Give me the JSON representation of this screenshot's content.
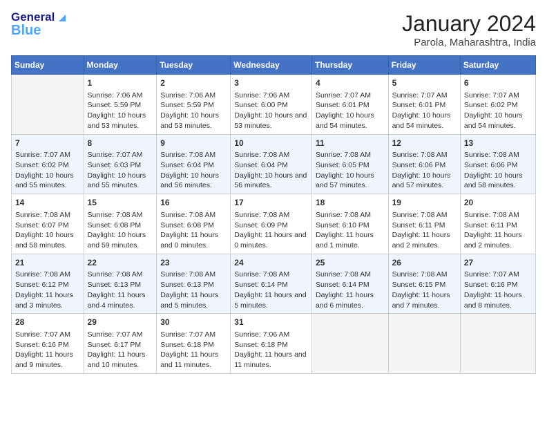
{
  "header": {
    "logo_general": "General",
    "logo_blue": "Blue",
    "title": "January 2024",
    "subtitle": "Parola, Maharashtra, India"
  },
  "days_of_week": [
    "Sunday",
    "Monday",
    "Tuesday",
    "Wednesday",
    "Thursday",
    "Friday",
    "Saturday"
  ],
  "weeks": [
    [
      {
        "day": "",
        "empty": true
      },
      {
        "day": "1",
        "sunrise": "Sunrise: 7:06 AM",
        "sunset": "Sunset: 5:59 PM",
        "daylight": "Daylight: 10 hours and 53 minutes."
      },
      {
        "day": "2",
        "sunrise": "Sunrise: 7:06 AM",
        "sunset": "Sunset: 5:59 PM",
        "daylight": "Daylight: 10 hours and 53 minutes."
      },
      {
        "day": "3",
        "sunrise": "Sunrise: 7:06 AM",
        "sunset": "Sunset: 6:00 PM",
        "daylight": "Daylight: 10 hours and 53 minutes."
      },
      {
        "day": "4",
        "sunrise": "Sunrise: 7:07 AM",
        "sunset": "Sunset: 6:01 PM",
        "daylight": "Daylight: 10 hours and 54 minutes."
      },
      {
        "day": "5",
        "sunrise": "Sunrise: 7:07 AM",
        "sunset": "Sunset: 6:01 PM",
        "daylight": "Daylight: 10 hours and 54 minutes."
      },
      {
        "day": "6",
        "sunrise": "Sunrise: 7:07 AM",
        "sunset": "Sunset: 6:02 PM",
        "daylight": "Daylight: 10 hours and 54 minutes."
      }
    ],
    [
      {
        "day": "7",
        "sunrise": "Sunrise: 7:07 AM",
        "sunset": "Sunset: 6:02 PM",
        "daylight": "Daylight: 10 hours and 55 minutes."
      },
      {
        "day": "8",
        "sunrise": "Sunrise: 7:07 AM",
        "sunset": "Sunset: 6:03 PM",
        "daylight": "Daylight: 10 hours and 55 minutes."
      },
      {
        "day": "9",
        "sunrise": "Sunrise: 7:08 AM",
        "sunset": "Sunset: 6:04 PM",
        "daylight": "Daylight: 10 hours and 56 minutes."
      },
      {
        "day": "10",
        "sunrise": "Sunrise: 7:08 AM",
        "sunset": "Sunset: 6:04 PM",
        "daylight": "Daylight: 10 hours and 56 minutes."
      },
      {
        "day": "11",
        "sunrise": "Sunrise: 7:08 AM",
        "sunset": "Sunset: 6:05 PM",
        "daylight": "Daylight: 10 hours and 57 minutes."
      },
      {
        "day": "12",
        "sunrise": "Sunrise: 7:08 AM",
        "sunset": "Sunset: 6:06 PM",
        "daylight": "Daylight: 10 hours and 57 minutes."
      },
      {
        "day": "13",
        "sunrise": "Sunrise: 7:08 AM",
        "sunset": "Sunset: 6:06 PM",
        "daylight": "Daylight: 10 hours and 58 minutes."
      }
    ],
    [
      {
        "day": "14",
        "sunrise": "Sunrise: 7:08 AM",
        "sunset": "Sunset: 6:07 PM",
        "daylight": "Daylight: 10 hours and 58 minutes."
      },
      {
        "day": "15",
        "sunrise": "Sunrise: 7:08 AM",
        "sunset": "Sunset: 6:08 PM",
        "daylight": "Daylight: 10 hours and 59 minutes."
      },
      {
        "day": "16",
        "sunrise": "Sunrise: 7:08 AM",
        "sunset": "Sunset: 6:08 PM",
        "daylight": "Daylight: 11 hours and 0 minutes."
      },
      {
        "day": "17",
        "sunrise": "Sunrise: 7:08 AM",
        "sunset": "Sunset: 6:09 PM",
        "daylight": "Daylight: 11 hours and 0 minutes."
      },
      {
        "day": "18",
        "sunrise": "Sunrise: 7:08 AM",
        "sunset": "Sunset: 6:10 PM",
        "daylight": "Daylight: 11 hours and 1 minute."
      },
      {
        "day": "19",
        "sunrise": "Sunrise: 7:08 AM",
        "sunset": "Sunset: 6:11 PM",
        "daylight": "Daylight: 11 hours and 2 minutes."
      },
      {
        "day": "20",
        "sunrise": "Sunrise: 7:08 AM",
        "sunset": "Sunset: 6:11 PM",
        "daylight": "Daylight: 11 hours and 2 minutes."
      }
    ],
    [
      {
        "day": "21",
        "sunrise": "Sunrise: 7:08 AM",
        "sunset": "Sunset: 6:12 PM",
        "daylight": "Daylight: 11 hours and 3 minutes."
      },
      {
        "day": "22",
        "sunrise": "Sunrise: 7:08 AM",
        "sunset": "Sunset: 6:13 PM",
        "daylight": "Daylight: 11 hours and 4 minutes."
      },
      {
        "day": "23",
        "sunrise": "Sunrise: 7:08 AM",
        "sunset": "Sunset: 6:13 PM",
        "daylight": "Daylight: 11 hours and 5 minutes."
      },
      {
        "day": "24",
        "sunrise": "Sunrise: 7:08 AM",
        "sunset": "Sunset: 6:14 PM",
        "daylight": "Daylight: 11 hours and 5 minutes."
      },
      {
        "day": "25",
        "sunrise": "Sunrise: 7:08 AM",
        "sunset": "Sunset: 6:14 PM",
        "daylight": "Daylight: 11 hours and 6 minutes."
      },
      {
        "day": "26",
        "sunrise": "Sunrise: 7:08 AM",
        "sunset": "Sunset: 6:15 PM",
        "daylight": "Daylight: 11 hours and 7 minutes."
      },
      {
        "day": "27",
        "sunrise": "Sunrise: 7:07 AM",
        "sunset": "Sunset: 6:16 PM",
        "daylight": "Daylight: 11 hours and 8 minutes."
      }
    ],
    [
      {
        "day": "28",
        "sunrise": "Sunrise: 7:07 AM",
        "sunset": "Sunset: 6:16 PM",
        "daylight": "Daylight: 11 hours and 9 minutes."
      },
      {
        "day": "29",
        "sunrise": "Sunrise: 7:07 AM",
        "sunset": "Sunset: 6:17 PM",
        "daylight": "Daylight: 11 hours and 10 minutes."
      },
      {
        "day": "30",
        "sunrise": "Sunrise: 7:07 AM",
        "sunset": "Sunset: 6:18 PM",
        "daylight": "Daylight: 11 hours and 11 minutes."
      },
      {
        "day": "31",
        "sunrise": "Sunrise: 7:06 AM",
        "sunset": "Sunset: 6:18 PM",
        "daylight": "Daylight: 11 hours and 11 minutes."
      },
      {
        "day": "",
        "empty": true
      },
      {
        "day": "",
        "empty": true
      },
      {
        "day": "",
        "empty": true
      }
    ]
  ]
}
